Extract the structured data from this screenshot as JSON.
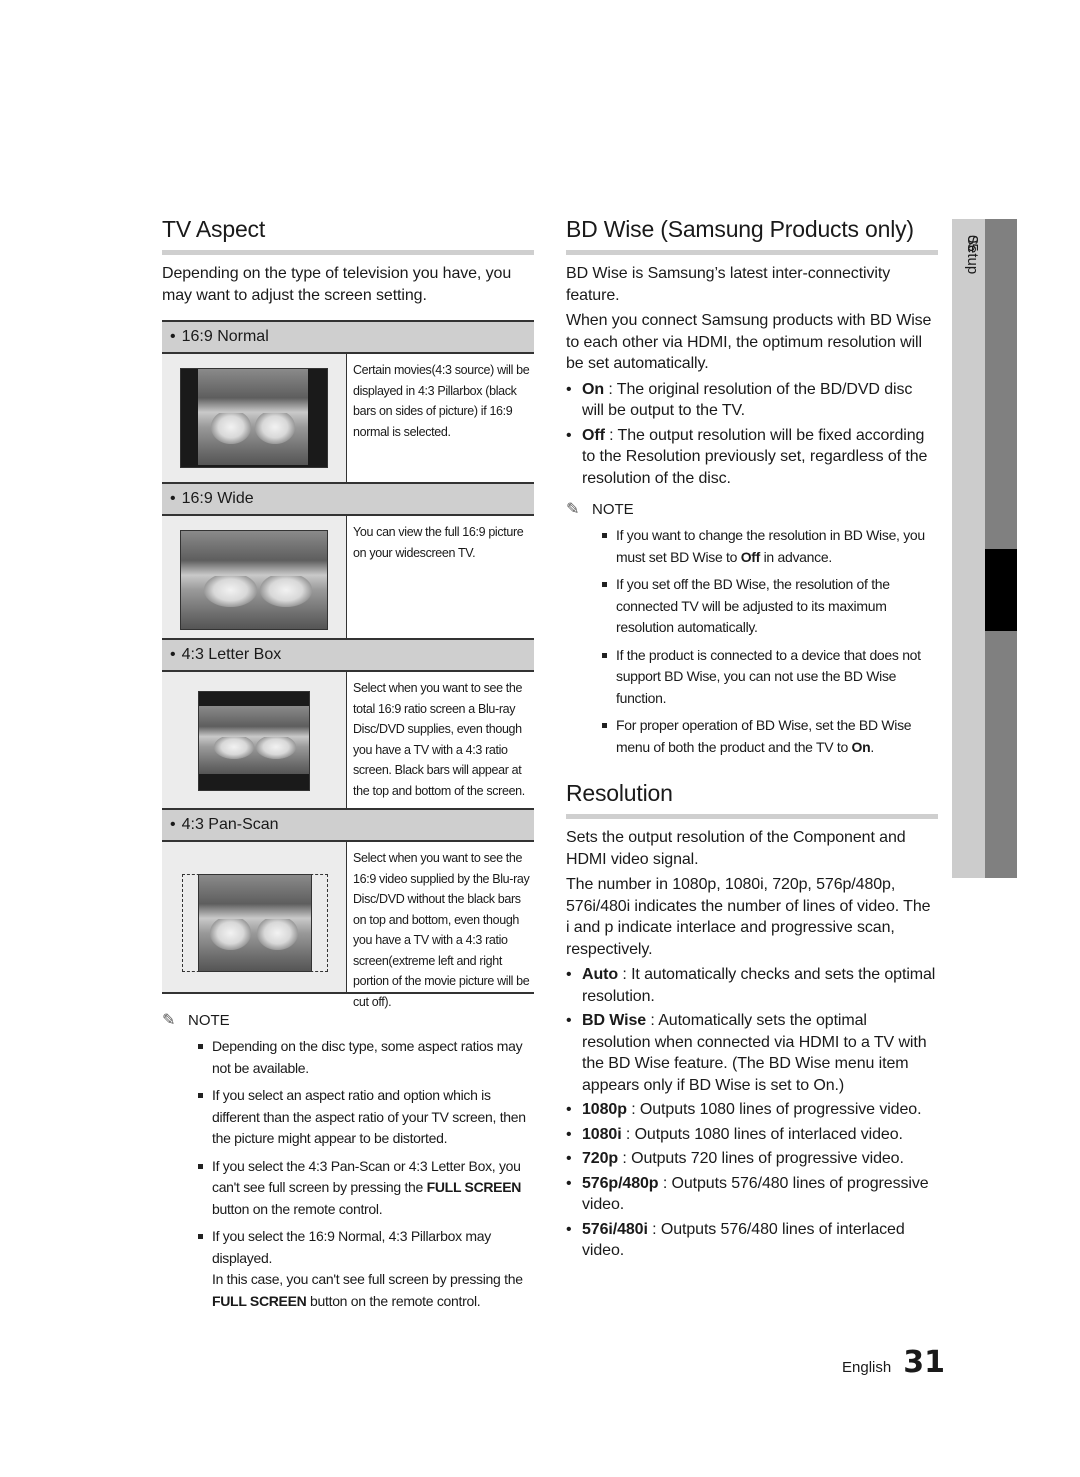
{
  "tv_aspect": {
    "title": "TV Aspect",
    "intro": "Depending on the type of television you have, you may want to adjust the screen setting.",
    "options": [
      {
        "label": "16:9 Normal",
        "picture": "pillarbox",
        "description": "Certain movies(4:3 source) will be displayed in 4:3 Pillarbox (black bars on sides of picture) if 16:9 normal is selected."
      },
      {
        "label": "16:9 Wide",
        "picture": "wide",
        "description": "You can view the full 16:9 picture on your widescreen TV."
      },
      {
        "label": "4:3 Letter Box",
        "picture": "letterbox",
        "description": "Select when you want to see the total 16:9 ratio screen a Blu-ray Disc/DVD supplies, even though you have a TV with a 4:3 ratio screen. Black bars will appear at the top and bottom of the screen."
      },
      {
        "label": "4:3 Pan-Scan",
        "picture": "panscan",
        "description": "Select when you want to see the 16:9 video supplied by the Blu-ray Disc/DVD without the black bars on top and bottom, even though you have a TV with a 4:3 ratio screen(extreme left and right portion of the movie picture will be cut off)."
      }
    ],
    "note": {
      "title": "NOTE",
      "icon": "pencil-icon",
      "items": [
        {
          "text": "Depending on the disc type, some aspect ratios may not be available."
        },
        {
          "text": "If you select an aspect ratio and option which is different than the aspect ratio of your TV screen, then the picture might appear to be distorted."
        },
        {
          "before": "If you select the 4:3 Pan-Scan or 4:3 Letter Box, you can't see full screen by pressing the ",
          "bold": "FULL SCREEN",
          "after": " button on the remote control."
        },
        {
          "line1": "If you select the 16:9 Normal, 4:3 Pillarbox may displayed.",
          "before": "In this case, you can't see full screen by pressing the ",
          "bold": "FULL SCREEN",
          "after": " button on the remote control."
        }
      ]
    }
  },
  "bd_wise": {
    "title": "BD Wise (Samsung Products only)",
    "paragraphs": [
      "BD Wise is Samsung’s latest inter-connectivity feature.",
      "When you connect Samsung products with BD Wise to each other via HDMI, the optimum resolution will be set automatically."
    ],
    "options": [
      {
        "term": "On",
        "text": " : The original resolution of the BD/DVD disc will be output to the TV."
      },
      {
        "term": "Off",
        "text": " : The output resolution will be fixed according to the Resolution previously set, regardless of the resolution of the disc."
      }
    ],
    "note": {
      "title": "NOTE",
      "icon": "pencil-icon",
      "items": [
        {
          "before": "If you want to change the resolution in BD Wise, you must set BD Wise to ",
          "bold": "Off",
          "after": " in advance."
        },
        {
          "before": "If you set off the BD Wise, the resolution of the connected TV will be adjusted to its maximum resolution automatically.",
          "bold": "",
          "after": ""
        },
        {
          "before": "If the product is connected to a device that does not support BD Wise, you can not use the BD Wise function.",
          "bold": "",
          "after": ""
        },
        {
          "before": "For proper operation of BD Wise, set the BD Wise menu of both the product and the TV to ",
          "bold": "On",
          "after": "."
        }
      ]
    }
  },
  "resolution": {
    "title": "Resolution",
    "paragraphs": [
      "Sets the output resolution of the Component and HDMI video signal.",
      "The number in 1080p, 1080i, 720p, 576p/480p, 576i/480i indicates the number of lines of video. The i and p indicate interlace and progressive scan, respectively."
    ],
    "options": [
      {
        "term": "Auto",
        "text": " : It automatically checks and sets the optimal resolution."
      },
      {
        "term": "BD Wise",
        "text": " : Automatically sets the optimal resolution when connected via HDMI to a TV with the BD Wise feature. (The BD Wise menu item appears only if BD Wise is set to On.)"
      },
      {
        "term": "1080p",
        "text": " : Outputs 1080 lines of progressive video."
      },
      {
        "term": "1080i",
        "text": " : Outputs 1080 lines of interlaced video."
      },
      {
        "term": "720p",
        "text": " : Outputs 720 lines of progressive video."
      },
      {
        "term": "576p/480p",
        "text": " : Outputs 576/480 lines of progressive video."
      },
      {
        "term": "576i/480i",
        "text": " : Outputs 576/480 lines of interlaced video."
      }
    ]
  },
  "side_tab": {
    "chapter_number": "05",
    "chapter_title": "Setup",
    "colors": {
      "light": "#cccccc",
      "dark": "#808080",
      "active": "#000000"
    }
  },
  "footer": {
    "language": "English",
    "page_number": "31"
  }
}
